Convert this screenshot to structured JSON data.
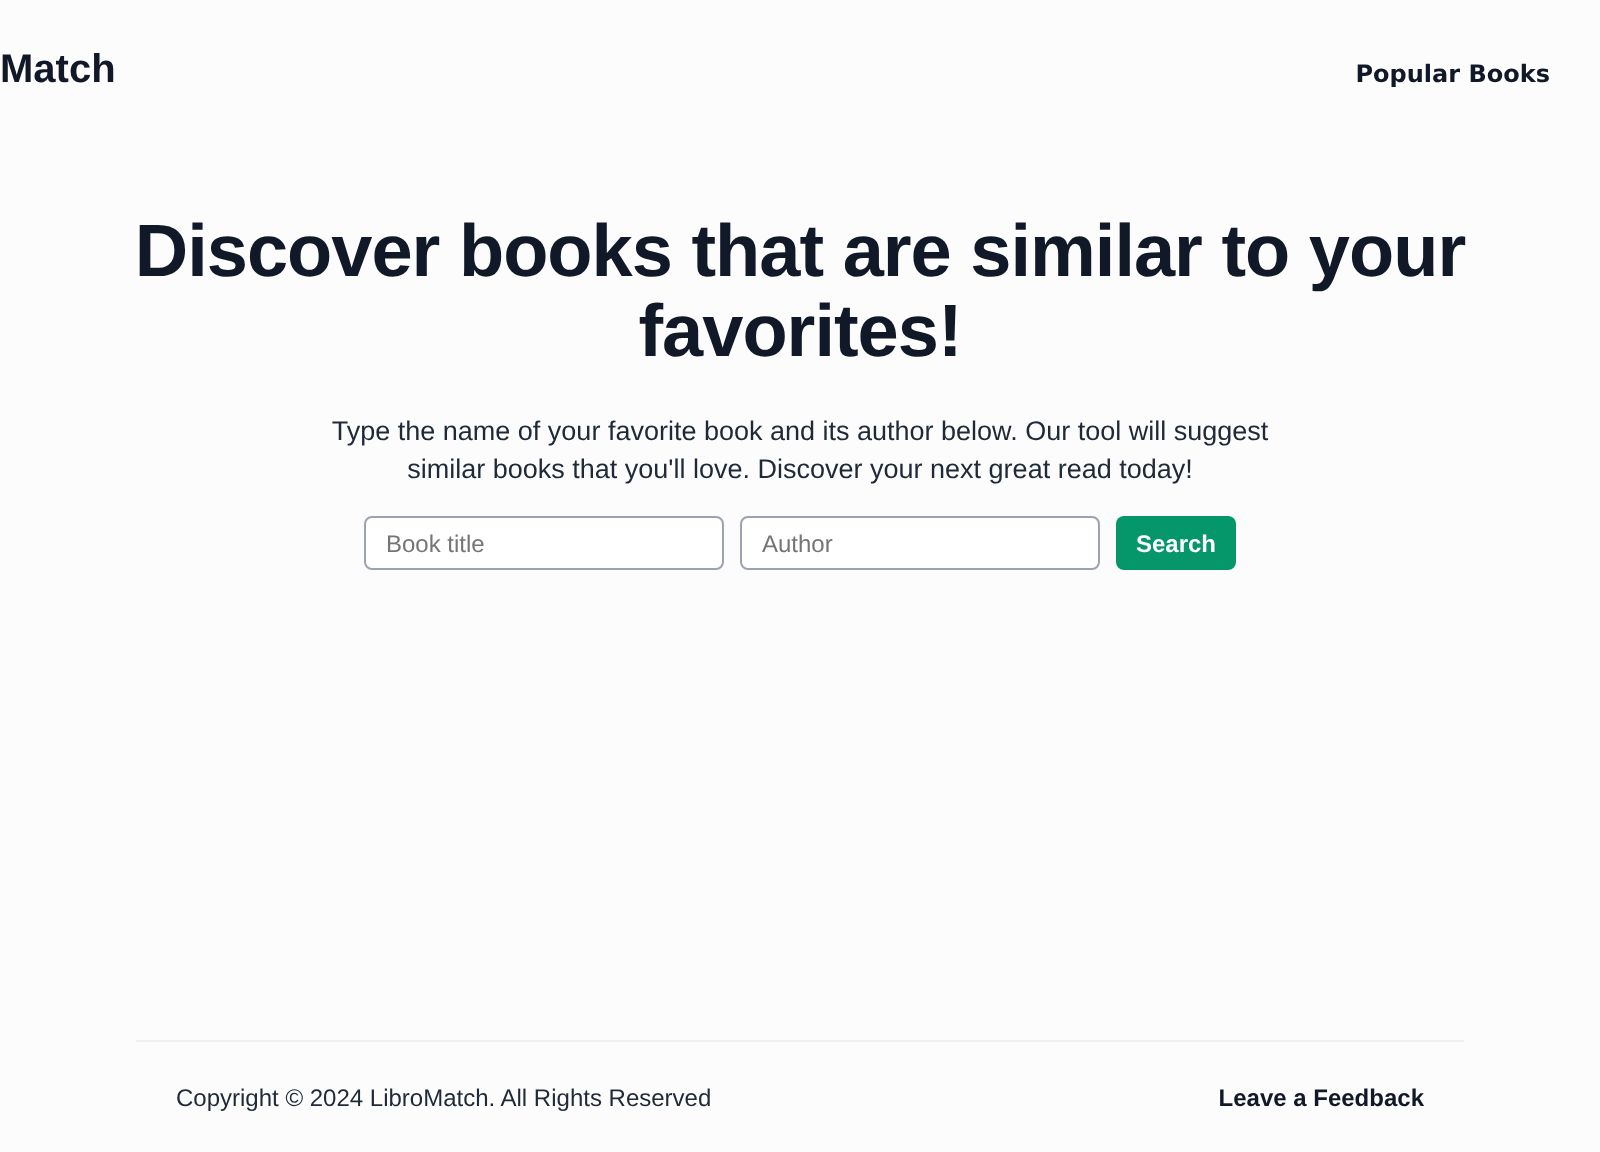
{
  "header": {
    "logo": "Match",
    "nav": [
      "Popular Books"
    ]
  },
  "hero": {
    "title": "Discover books that are similar to your favorites!",
    "subtitle": "Type the name of your favorite book and its author below. Our tool will suggest similar books that you'll love. Discover your next great read today!"
  },
  "search": {
    "fields": [
      {
        "placeholder": "Book title"
      },
      {
        "placeholder": "Author"
      }
    ],
    "button": "Search"
  },
  "footer": {
    "copyright": "Copyright © 2024 LibroMatch. All Rights Reserved",
    "link": "Leave a Feedback"
  }
}
